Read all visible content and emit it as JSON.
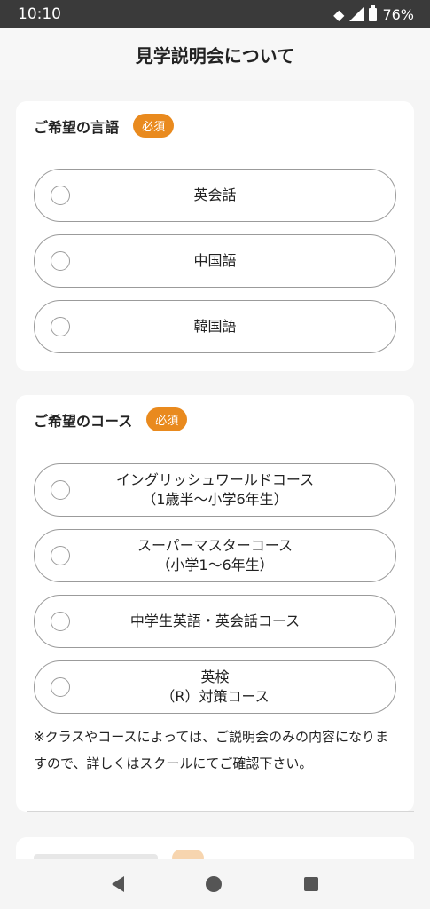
{
  "status": {
    "time": "10:10",
    "battery": "76%"
  },
  "page": {
    "title": "見学説明会について"
  },
  "languages": {
    "label": "ご希望の言語",
    "required": "必須",
    "options": [
      "英会話",
      "中国語",
      "韓国語"
    ]
  },
  "courses": {
    "label": "ご希望のコース",
    "required": "必須",
    "options": [
      {
        "line1": "イングリッシュワールドコース",
        "line2": "（1歳半〜小学6年生）"
      },
      {
        "line1": "スーパーマスターコース",
        "line2": "（小学1〜6年生）"
      },
      {
        "line1": "中学生英語・英会話コース",
        "line2": ""
      },
      {
        "line1": "英検",
        "line2": "（R）対策コース"
      }
    ],
    "note": "※クラスやコースによっては、ご説明会のみの内容になりますので、詳しくはスクールにてご確認下さい。"
  }
}
